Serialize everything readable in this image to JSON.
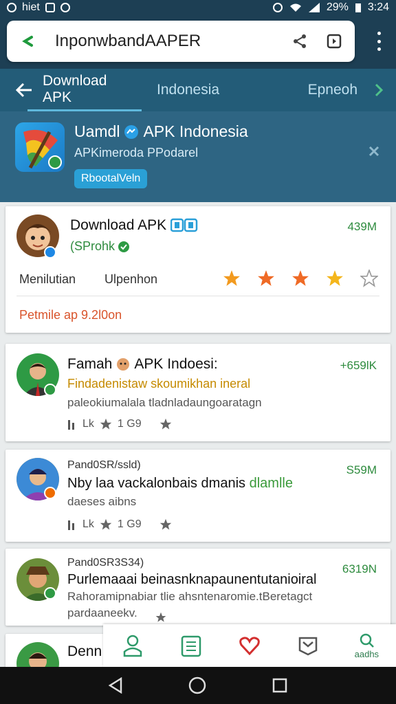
{
  "status_bar": {
    "left_text": "hiet",
    "battery": "29%",
    "time": "3:24",
    "icons": [
      "notification-icon",
      "image-icon",
      "vibrate-icon",
      "alarm-icon",
      "wifi-icon",
      "signal-icon",
      "battery-icon"
    ]
  },
  "url_bar": {
    "url": "InponwbandAAPER",
    "icons": [
      "site-logo-icon",
      "share-icon",
      "tabs-icon",
      "overflow-menu-icon"
    ]
  },
  "tabs": [
    {
      "label": "Download APK",
      "active": true
    },
    {
      "label": "Indonesia",
      "active": false
    },
    {
      "label": "Epneoh",
      "active": false
    }
  ],
  "promo": {
    "title": "Uamdl",
    "title_suffix": "APK Indonesia",
    "subtitle": "APKimeroda PPodarel",
    "pill": "RbootalVeln"
  },
  "cards": [
    {
      "title": "Download APK",
      "subtitle": "(SProhk",
      "size": "439M",
      "labels": [
        "Menilutian",
        "Ulpenhon"
      ],
      "rating_stars": 4,
      "rating_max": 5,
      "footer": "Petmile ap 9.2l0on"
    },
    {
      "title": "Famah",
      "title_suffix": "APK Indoesi:",
      "size": "+659lK",
      "line1": "Findadenistaw skoumikhan",
      "line1_highlight": "ineral",
      "line2": "paleokiumalala tladnladaungoaratagn",
      "meta_count": "Lk",
      "meta_rating": "1 G9"
    },
    {
      "title": "Pand0SR/ssld)",
      "size": "S59M",
      "line1": "Nby laa vackalonbais dmanis",
      "line1_highlight": "dlamlle",
      "line2": "daeses aibns",
      "meta_count": "Lk",
      "meta_rating": "1 G9"
    },
    {
      "title": "Pand0SR3S34)",
      "size": "6319N",
      "line1": "Purlemaaai beinasnknapaunentutanioiral",
      "line2": "Rahoramipnabiar tlie ahsntenaromie.tBeretagct",
      "line3": "pardaaneekv."
    },
    {
      "title": "Denn"
    }
  ],
  "bottom_nav": [
    {
      "icon": "profile-icon",
      "label": ""
    },
    {
      "icon": "document-icon",
      "label": ""
    },
    {
      "icon": "heart-icon",
      "label": ""
    },
    {
      "icon": "inbox-icon",
      "label": ""
    },
    {
      "icon": "search-icon",
      "label": "aadhs"
    }
  ],
  "colors": {
    "header_dark": "#1d3f54",
    "tabbar": "#235c78",
    "promo": "#2e6583",
    "accent_green": "#2e8b3e",
    "star": "#f29a1f",
    "footer_red": "#d9542b"
  }
}
